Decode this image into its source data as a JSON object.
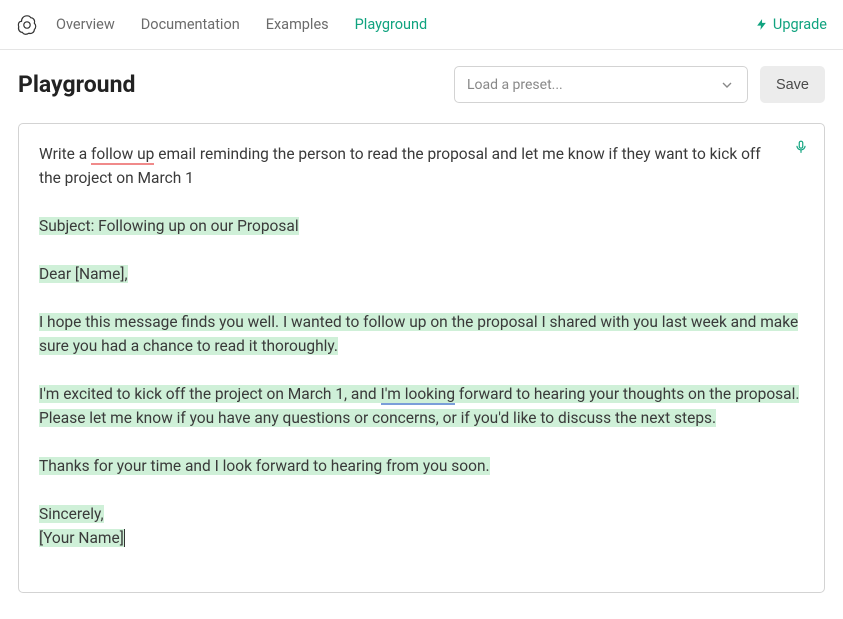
{
  "nav": {
    "links": {
      "overview": "Overview",
      "documentation": "Documentation",
      "examples": "Examples",
      "playground": "Playground"
    },
    "upgrade": "Upgrade"
  },
  "header": {
    "title": "Playground",
    "preset_placeholder": "Load a preset...",
    "save_label": "Save"
  },
  "editor": {
    "prompt_pre": "Write a ",
    "prompt_underlined": "follow up",
    "prompt_post": " email reminding the person to read the proposal and let me know if they want to kick off the project on March 1",
    "completion": {
      "subject": "Subject: Following up on our Proposal",
      "greeting": "Dear [Name],",
      "p1": "I hope this message finds you well. I wanted to follow up on the proposal I shared with you last week and make sure you had a chance to read it thoroughly.",
      "p2_a": "I'm excited to kick off the project on March 1, and ",
      "p2_u": "I'm looking",
      "p2_b": " forward to hearing your thoughts on the proposal. Please let me know if you have any questions or concerns, or if you'd like to discuss the next steps.",
      "p3": "Thanks for your time and I look forward to hearing from you soon.",
      "closing": "Sincerely,",
      "signature": "[Your Name]"
    }
  }
}
